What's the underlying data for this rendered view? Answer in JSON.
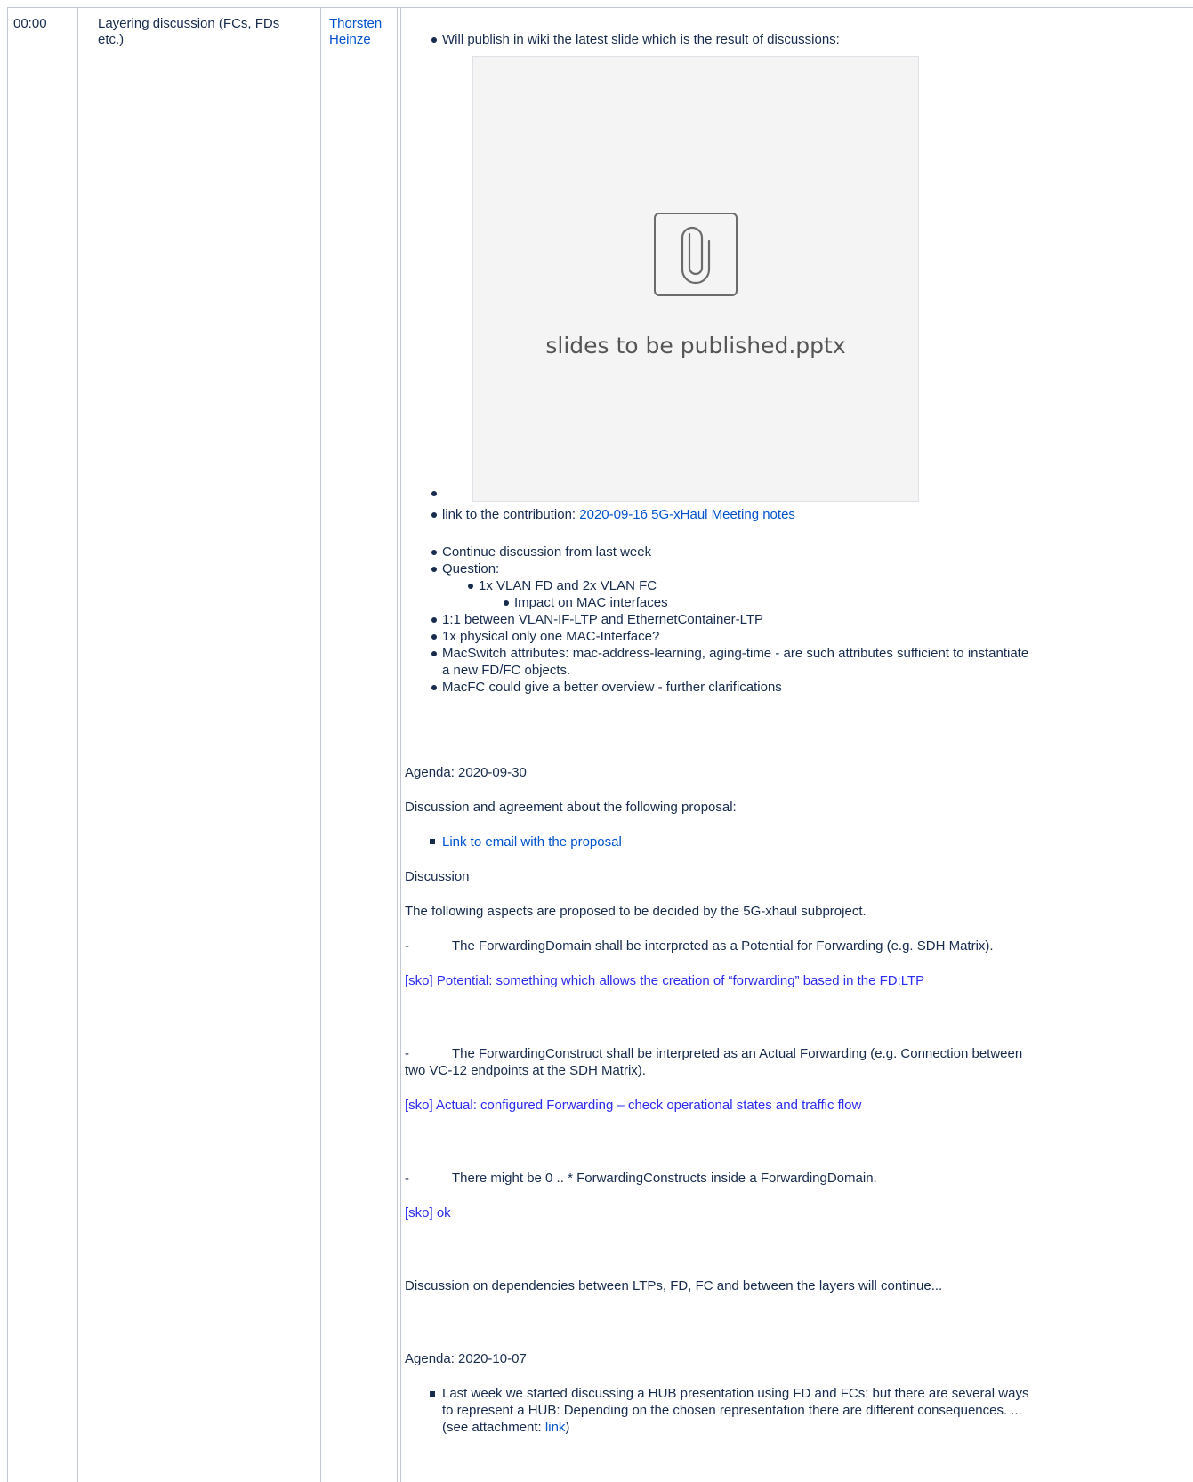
{
  "row": {
    "time": "00:00",
    "item_line1": "Layering discussion (FCs, FDs",
    "item_line2": "etc.)",
    "presenter_line1": "Thorsten",
    "presenter_line2": "Heinze"
  },
  "notes": {
    "publish_bullet": "Will publish in wiki the latest slide which is the result of discussions:",
    "attachment_name": "slides to be published.pptx",
    "contribution_prefix": "link to the contribution: ",
    "contribution_link": "2020-09-16 5G-xHaul Meeting notes",
    "bullets": [
      "Continue discussion from last week",
      "Question:",
      "1x VLAN FD and 2x VLAN FC",
      "Impact on MAC interfaces",
      "1:1 between VLAN-IF-LTP and EthernetContainer-LTP",
      "1x physical  only one MAC-Interface?",
      "MacSwitch attributes: mac-address-learning, aging-time - are such attributes sufficient to instantiate",
      "a new FD/FC objects.",
      "MacFC could give a better overview - further clarifications"
    ],
    "agenda1": "Agenda: 2020-09-30",
    "discussion_intro": "Discussion and agreement about the following proposal:",
    "email_link": "Link to email with the proposal",
    "discussion_label": "Discussion",
    "aspects_intro": "The following aspects are proposed to be decided by the 5G-xhaul subproject.",
    "dash": "-",
    "fd_statement": "The ForwardingDomain shall be interpreted as a Potential for Forwarding (e.g. SDH Matrix).",
    "sko1": "[sko] Potential: something which allows the creation of “forwarding” based in the FD:LTP",
    "fc_statement_1": "The ForwardingConstruct shall be interpreted as an Actual Forwarding (e.g. Connection between",
    "fc_statement_2": "two VC-12 endpoints at the SDH Matrix).",
    "sko2": "[sko] Actual: configured Forwarding – check operational states and traffic flow",
    "count_statement": "There might be 0 .. * ForwardingConstructs inside a ForwardingDomain.",
    "sko3": "[sko] ok",
    "dependencies": "Discussion on dependencies between LTPs, FD, FC and between the layers will continue...",
    "agenda2": "Agenda: 2020-10-07",
    "hub_line1": "Last week we started discussing a HUB presentation using FD and FCs: but there are several ways",
    "hub_line2": "to represent a HUB: Depending on the chosen representation there are different consequences. ...",
    "hub_line3_prefix": "(see attachment: ",
    "hub_link": "link",
    "hub_line3_suffix": ")"
  },
  "colors": {
    "text": "#172b4d",
    "link": "#0052cc",
    "sko": "#2c2cf0",
    "border": "#c1c7d0"
  },
  "icons": [
    "paperclip-icon"
  ]
}
